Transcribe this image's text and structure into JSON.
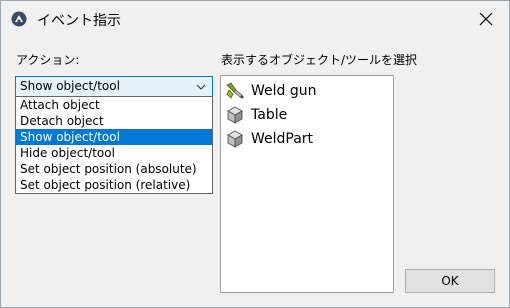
{
  "window": {
    "title": "イベント指示"
  },
  "action": {
    "label": "アクション:",
    "selected_value": "Show object/tool",
    "options": [
      "Attach object",
      "Detach object",
      "Show object/tool",
      "Hide object/tool",
      "Set object position (absolute)",
      "Set object position (relative)"
    ],
    "selected_index": 2
  },
  "object_select": {
    "label": "表示するオブジェクト/ツールを選択",
    "items": [
      {
        "label": "Weld gun",
        "icon": "weld-gun-icon"
      },
      {
        "label": "Table",
        "icon": "cube-icon"
      },
      {
        "label": "WeldPart",
        "icon": "cube-icon"
      }
    ]
  },
  "buttons": {
    "ok": "OK"
  },
  "colors": {
    "selection": "#0078d7",
    "combo_bg": "#e5f1fb",
    "window_bg": "#f0f0f0"
  }
}
